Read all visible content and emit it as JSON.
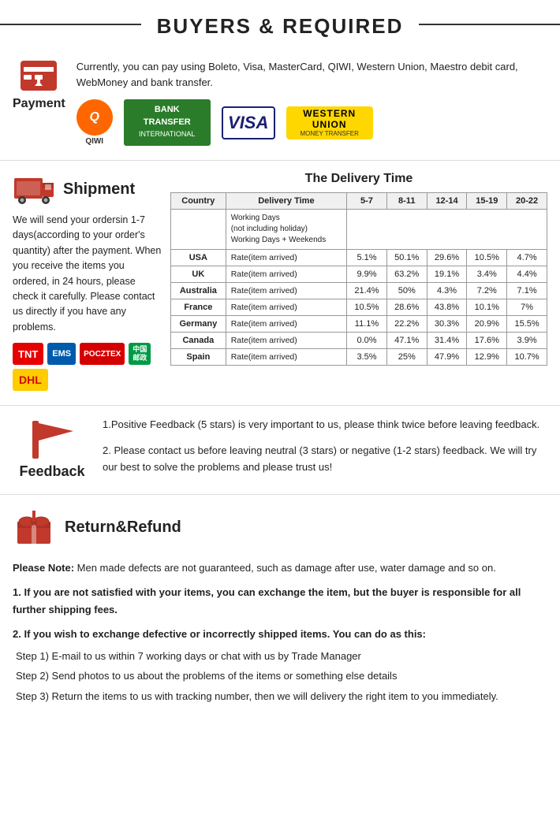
{
  "header": {
    "title": "BUYERS & REQUIRED"
  },
  "payment": {
    "section_title": "Payment",
    "description": "Currently, you can pay using Boleto, Visa, MasterCard, QIWI, Western Union, Maestro  debit card, WebMoney and bank transfer.",
    "logos": [
      "QIWI",
      "BANK TRANSFER",
      "VISA",
      "WESTERN UNION"
    ]
  },
  "shipment": {
    "section_title": "Shipment",
    "description": "We will send your ordersin 1-7 days(according to your order's quantity) after the payment. When you receive the items you ordered, in 24  hours, please check it carefully. Please  contact us directly if you have any problems.",
    "delivery_title": "The Delivery Time",
    "table": {
      "col_headers": [
        "Country",
        "Delivery Time",
        "5-7",
        "8-11",
        "12-14",
        "15-19",
        "20-22"
      ],
      "working_days_label": "Working Days\n(not including holiday)\nWorking Days + Weekends",
      "rows": [
        {
          "country": "USA",
          "rate_label": "Rate(item arrived)",
          "c1": "5.1%",
          "c2": "50.1%",
          "c3": "29.6%",
          "c4": "10.5%",
          "c5": "4.7%"
        },
        {
          "country": "UK",
          "rate_label": "Rate(item arrived)",
          "c1": "9.9%",
          "c2": "63.2%",
          "c3": "19.1%",
          "c4": "3.4%",
          "c5": "4.4%"
        },
        {
          "country": "Australia",
          "rate_label": "Rate(item arrived)",
          "c1": "21.4%",
          "c2": "50%",
          "c3": "4.3%",
          "c4": "7.2%",
          "c5": "7.1%"
        },
        {
          "country": "France",
          "rate_label": "Rate(item arrived)",
          "c1": "10.5%",
          "c2": "28.6%",
          "c3": "43.8%",
          "c4": "10.1%",
          "c5": "7%"
        },
        {
          "country": "Germany",
          "rate_label": "Rate(item arrived)",
          "c1": "11.1%",
          "c2": "22.2%",
          "c3": "30.3%",
          "c4": "20.9%",
          "c5": "15.5%"
        },
        {
          "country": "Canada",
          "rate_label": "Rate(item arrived)",
          "c1": "0.0%",
          "c2": "47.1%",
          "c3": "31.4%",
          "c4": "17.6%",
          "c5": "3.9%"
        },
        {
          "country": "Spain",
          "rate_label": "Rate(item arrived)",
          "c1": "3.5%",
          "c2": "25%",
          "c3": "47.9%",
          "c4": "12.9%",
          "c5": "10.7%"
        }
      ]
    }
  },
  "feedback": {
    "section_title": "Feedback",
    "text1": "1.Positive Feedback (5 stars) is very important to us, please think twice before leaving feedback.",
    "text2": "2. Please contact us before leaving neutral (3 stars) or negative  (1-2 stars) feedback. We will try our best to solve the problems and please trust us!"
  },
  "return_refund": {
    "section_title": "Return&Refund",
    "note_bold": "Please Note:",
    "note_text": " Men made defects are not guaranteed, such as damage after use, water damage and so on.",
    "point1": "1. If you are not satisfied with your items, you can exchange the item, but the buyer is responsible for all further shipping fees.",
    "point2_bold": "2. If you wish to exchange defective or incorrectly shipped items. You can do as this:",
    "step1": "Step 1) E-mail to us within 7 working days or chat with us by Trade Manager",
    "step2": "Step 2) Send photos to us about the problems of the items or something else details",
    "step3": "Step 3) Return the items to us with tracking number, then we will delivery the right item to you immediately."
  }
}
